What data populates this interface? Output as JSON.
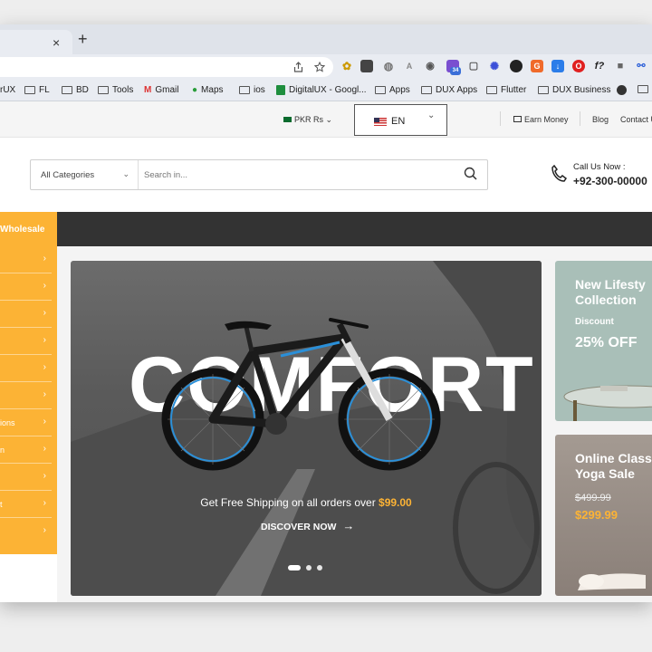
{
  "browser": {
    "new_tab": "+",
    "close_tab": "×",
    "bookmarks": [
      "rUX",
      "FL",
      "BD",
      "Tools",
      "Gmail",
      "Maps",
      "ios",
      "DigitalUX - Googl...",
      "Apps",
      "DUX Apps",
      "Flutter",
      "DUX Business"
    ],
    "ext_badge": "34"
  },
  "topbar": {
    "currency": "PKR Rs",
    "language": "EN",
    "earn_money": "Earn Money",
    "blog": "Blog",
    "contact": "Contact U"
  },
  "header": {
    "category_select": "All Categories",
    "search_placeholder": "Search in...",
    "call_label": "Call Us Now :",
    "call_number": "+92-300-00000"
  },
  "nav": {
    "departments": "Wholesale"
  },
  "sidebar": {
    "items": [
      "",
      "",
      "",
      "",
      "",
      "",
      "ions",
      "n",
      "",
      "t",
      ""
    ]
  },
  "hero": {
    "big_text": "COMFORT",
    "shipping_text": "Get Free Shipping on all orders over",
    "shipping_price": "$99.00",
    "cta": "DISCOVER NOW",
    "slide_count": 3
  },
  "promos": [
    {
      "title_line1": "New Lifesty",
      "title_line2": "Collection",
      "label": "Discount",
      "value": "25% OFF"
    },
    {
      "title_line1": "Online Class",
      "title_line2": "Yoga Sale",
      "old_price": "$499.99",
      "new_price": "$299.99"
    }
  ],
  "colors": {
    "accent": "#fcb335",
    "nav": "#333333",
    "chrome": "#e9ecf2"
  }
}
